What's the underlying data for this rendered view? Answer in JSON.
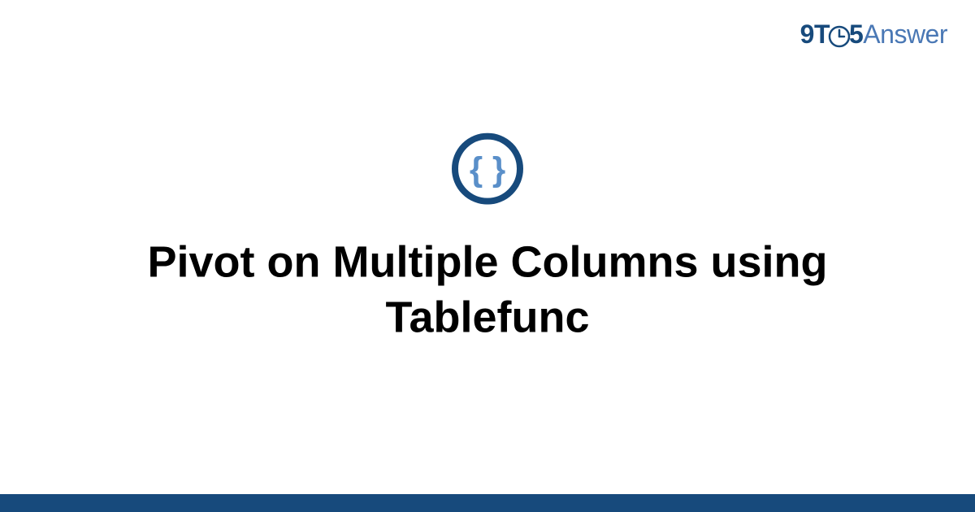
{
  "brand": {
    "part1": "9T",
    "part2": "5",
    "part3": "Answer"
  },
  "icon_name": "code-braces-icon",
  "title": "Pivot on Multiple Columns using Tablefunc",
  "colors": {
    "brand_dark": "#174a7c",
    "brand_light": "#4a78b5",
    "icon_inner": "#5a8fc9"
  }
}
